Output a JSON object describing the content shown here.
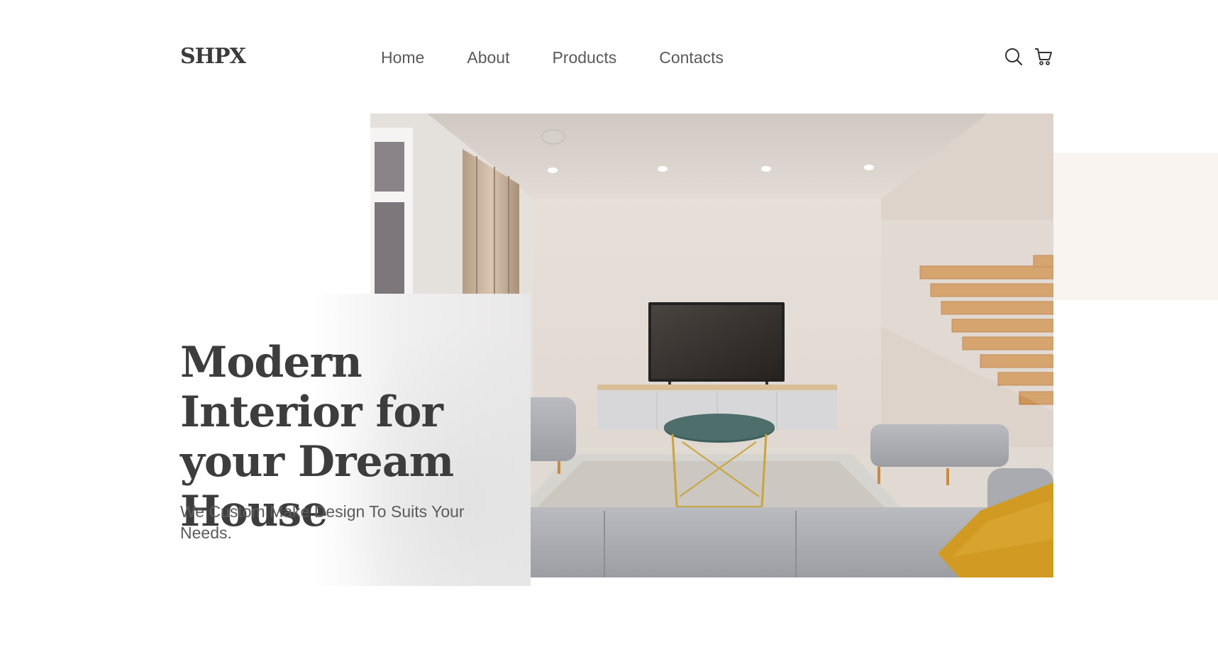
{
  "brand": {
    "logo": "SHPX"
  },
  "nav": {
    "items": [
      {
        "label": "Home"
      },
      {
        "label": "About"
      },
      {
        "label": "Products"
      },
      {
        "label": "Contacts"
      }
    ]
  },
  "header_icons": [
    "search-icon",
    "cart-icon"
  ],
  "hero": {
    "headline": "Modern Interior for your Dream House",
    "subtitle": "We Custom Make Design To Suits Your Needs."
  },
  "colors": {
    "text_dark": "#3d3d3d",
    "nav_text": "#5a5a5a",
    "beige_accent": "#f9f4ef",
    "pillow": "#d19a22",
    "sofa": "#a9abb0",
    "stair_wood": "#c8894b"
  }
}
